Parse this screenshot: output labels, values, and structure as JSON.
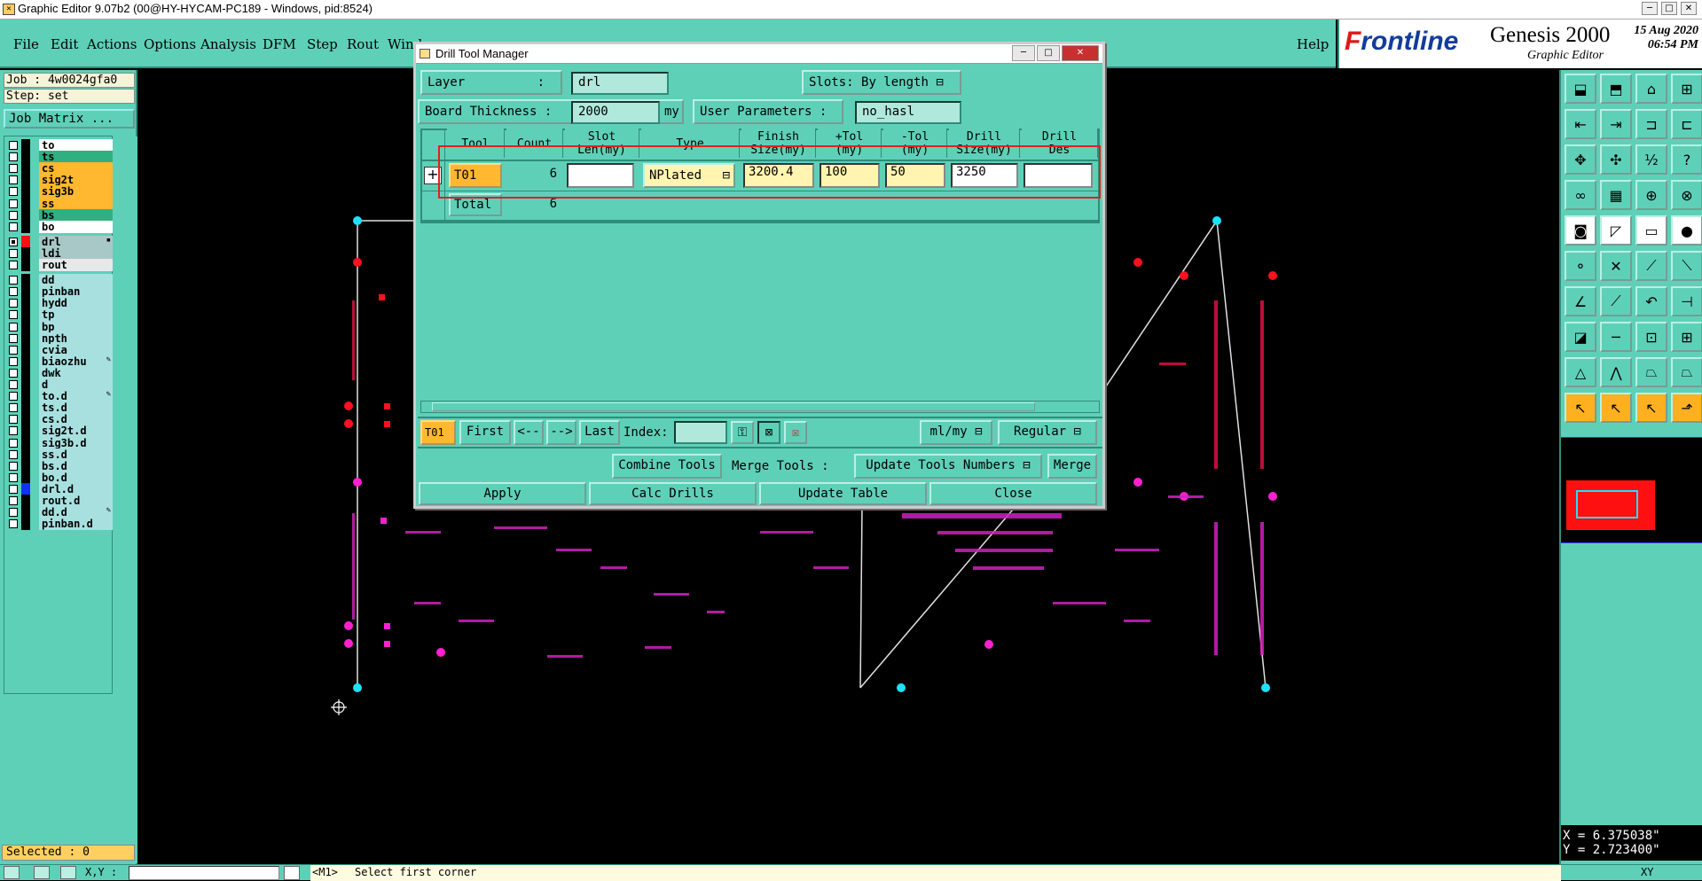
{
  "window": {
    "title": "Graphic Editor 9.07b2 (00@HY-HYCAM-PC189 - Windows, pid:8524)"
  },
  "menu": {
    "items": [
      "File",
      "Edit",
      "Actions",
      "Options",
      "Analysis",
      "DFM",
      "Step",
      "Rout",
      "Wind"
    ],
    "help": "Help"
  },
  "brand": {
    "logo_f": "F",
    "logo_rest": "rontline",
    "product": "Genesis 2000",
    "subtitle": "Graphic Editor",
    "date": "15 Aug 2020",
    "time": "06:54 PM"
  },
  "job": {
    "job": "Job : 4w0024gfa0",
    "step": "Step: set",
    "matrix_button": "Job Matrix ..."
  },
  "layers": [
    {
      "name": "to",
      "bg": "#ffffff",
      "checked": false,
      "swatch": "#000000",
      "mark": ""
    },
    {
      "name": "ts",
      "bg": "#30b080",
      "checked": false,
      "swatch": "#000000",
      "mark": ""
    },
    {
      "name": "cs",
      "bg": "#ffb830",
      "checked": false,
      "swatch": "#000000",
      "mark": ""
    },
    {
      "name": "sig2t",
      "bg": "#ffb830",
      "checked": false,
      "swatch": "#000000",
      "mark": ""
    },
    {
      "name": "sig3b",
      "bg": "#ffb830",
      "checked": false,
      "swatch": "#000000",
      "mark": ""
    },
    {
      "name": "ss",
      "bg": "#ffb830",
      "checked": false,
      "swatch": "#000000",
      "mark": ""
    },
    {
      "name": "bs",
      "bg": "#30b080",
      "checked": false,
      "swatch": "#000000",
      "mark": ""
    },
    {
      "name": "bo",
      "bg": "#ffffff",
      "checked": false,
      "swatch": "#000000",
      "mark": ""
    },
    {
      "name": "drl",
      "bg": "#a8c8c8",
      "checked": true,
      "swatch": "#ff1010",
      "mark": "▪"
    },
    {
      "name": "ldi",
      "bg": "#a8c8c8",
      "checked": false,
      "swatch": "#000000",
      "mark": ""
    },
    {
      "name": "rout",
      "bg": "#e8e8e8",
      "checked": false,
      "swatch": "#000000",
      "mark": ""
    },
    {
      "name": "dd",
      "bg": "#a8e0e0",
      "checked": false,
      "swatch": "#000000",
      "mark": ""
    },
    {
      "name": "pinban",
      "bg": "#a8e0e0",
      "checked": false,
      "swatch": "#000000",
      "mark": ""
    },
    {
      "name": "hydd",
      "bg": "#a8e0e0",
      "checked": false,
      "swatch": "#000000",
      "mark": ""
    },
    {
      "name": "tp",
      "bg": "#a8e0e0",
      "checked": false,
      "swatch": "#000000",
      "mark": ""
    },
    {
      "name": "bp",
      "bg": "#a8e0e0",
      "checked": false,
      "swatch": "#000000",
      "mark": ""
    },
    {
      "name": "npth",
      "bg": "#a8e0e0",
      "checked": false,
      "swatch": "#000000",
      "mark": ""
    },
    {
      "name": "cvia",
      "bg": "#a8e0e0",
      "checked": false,
      "swatch": "#000000",
      "mark": ""
    },
    {
      "name": "biaozhu",
      "bg": "#a8e0e0",
      "checked": false,
      "swatch": "#000000",
      "mark": "✎"
    },
    {
      "name": "dwk",
      "bg": "#a8e0e0",
      "checked": false,
      "swatch": "#000000",
      "mark": ""
    },
    {
      "name": "d",
      "bg": "#a8e0e0",
      "checked": false,
      "swatch": "#000000",
      "mark": ""
    },
    {
      "name": "to.d",
      "bg": "#a8e0e0",
      "checked": false,
      "swatch": "#000000",
      "mark": "✎"
    },
    {
      "name": "ts.d",
      "bg": "#a8e0e0",
      "checked": false,
      "swatch": "#000000",
      "mark": ""
    },
    {
      "name": "cs.d",
      "bg": "#a8e0e0",
      "checked": false,
      "swatch": "#000000",
      "mark": ""
    },
    {
      "name": "sig2t.d",
      "bg": "#a8e0e0",
      "checked": false,
      "swatch": "#000000",
      "mark": ""
    },
    {
      "name": "sig3b.d",
      "bg": "#a8e0e0",
      "checked": false,
      "swatch": "#000000",
      "mark": ""
    },
    {
      "name": "ss.d",
      "bg": "#a8e0e0",
      "checked": false,
      "swatch": "#000000",
      "mark": ""
    },
    {
      "name": "bs.d",
      "bg": "#a8e0e0",
      "checked": false,
      "swatch": "#000000",
      "mark": ""
    },
    {
      "name": "bo.d",
      "bg": "#a8e0e0",
      "checked": false,
      "swatch": "#000000",
      "mark": ""
    },
    {
      "name": "drl.d",
      "bg": "#a8e0e0",
      "checked": false,
      "swatch": "#1030ff",
      "mark": ""
    },
    {
      "name": "rout.d",
      "bg": "#a8e0e0",
      "checked": false,
      "swatch": "#000000",
      "mark": ""
    },
    {
      "name": "dd.d",
      "bg": "#a8e0e0",
      "checked": false,
      "swatch": "#000000",
      "mark": "✎"
    },
    {
      "name": "pinban.d",
      "bg": "#a8e0e0",
      "checked": false,
      "swatch": "#000000",
      "mark": ""
    }
  ],
  "selected": "Selected : 0",
  "dialog": {
    "title": "Drill Tool Manager",
    "layer_label": "Layer",
    "layer_colon": ":",
    "layer_value": "drl",
    "slots_label": "Slots:",
    "slots_value": "By length",
    "thickness_label": "Board Thickness :",
    "thickness_value": "2000",
    "thickness_unit": "my",
    "user_params_label": "User Parameters :",
    "user_params_value": "no_hasl",
    "columns": [
      {
        "l1": "Tool",
        "l2": ""
      },
      {
        "l1": "Count",
        "l2": ""
      },
      {
        "l1": "Slot",
        "l2": "Len(my)"
      },
      {
        "l1": "Type",
        "l2": ""
      },
      {
        "l1": "Finish",
        "l2": "Size(my)"
      },
      {
        "l1": "+Tol",
        "l2": "(my)"
      },
      {
        "l1": "-Tol",
        "l2": "(my)"
      },
      {
        "l1": "Drill",
        "l2": "Size(my)"
      },
      {
        "l1": "Drill",
        "l2": "Des"
      }
    ],
    "row": {
      "tool": "T01",
      "count": "6",
      "slot_len": "",
      "type": "NPlated",
      "finish": "3200.4",
      "ptol": "100",
      "mtol": "50",
      "drill": "3250",
      "des": ""
    },
    "total": {
      "label": "Total",
      "count": "6"
    },
    "nav": {
      "current": "T01",
      "first": "First",
      "prev": "<--",
      "next": "-->",
      "last": "Last",
      "index_label": "Index:",
      "index_value": "",
      "units": "ml/my",
      "mode": "Regular"
    },
    "combine_label": "Combine Tools",
    "merge_label": "Merge Tools :",
    "merge_mode": "Update Tools Numbers",
    "merge_button": "Merge",
    "apply": "Apply",
    "calc": "Calc Drills",
    "update": "Update Table",
    "close": "Close"
  },
  "coords": {
    "x": "X = 6.375038\"",
    "y": "Y = 2.723400\""
  },
  "status": {
    "xy_label": "X,Y :",
    "prompt_tag": "<M1>",
    "prompt": "Select first corner",
    "right_label": "XY"
  }
}
